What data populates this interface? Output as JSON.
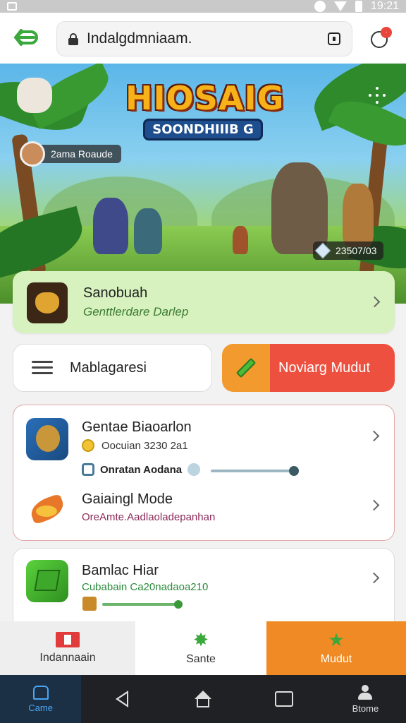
{
  "status_bar": {
    "time": "19:21"
  },
  "address_bar": {
    "url": "Indalgdmniaam."
  },
  "hero": {
    "logo_title": "HIOSAIG",
    "logo_subtitle": "SOONDHIIIB G",
    "player_label": "2ama Roaude",
    "score": "23507/03"
  },
  "featured": {
    "title": "Sanobuah",
    "subtitle": "Genttlerdare Darlep"
  },
  "buttons": {
    "menu_label": "Mablagaresi",
    "nav_label": "Noviarg Mudut"
  },
  "list1": [
    {
      "title": "Gentae Biaoarlon",
      "sub": "Oocuian 3230 2a1",
      "progress_label": "Onratan Aodana",
      "progress": 0.85
    },
    {
      "title": "Gaiaingl Mode",
      "sub": "OreAmte.Aadlaoladepanhan"
    }
  ],
  "list2": [
    {
      "title": "Bamlac Hiar",
      "sub": "Cubabain Ca20nadaoa210",
      "progress": 0.9
    }
  ],
  "bottom_tabs": [
    {
      "label": "Indannaain"
    },
    {
      "label": "Sante"
    },
    {
      "label": "Mudut"
    }
  ],
  "system_nav": {
    "left_label": "Came",
    "right_label": "Btome"
  },
  "colors": {
    "accent_green": "#3aa83a",
    "accent_orange": "#f08a25",
    "accent_red": "#ee5040",
    "featured_bg": "#d7f2bf"
  }
}
